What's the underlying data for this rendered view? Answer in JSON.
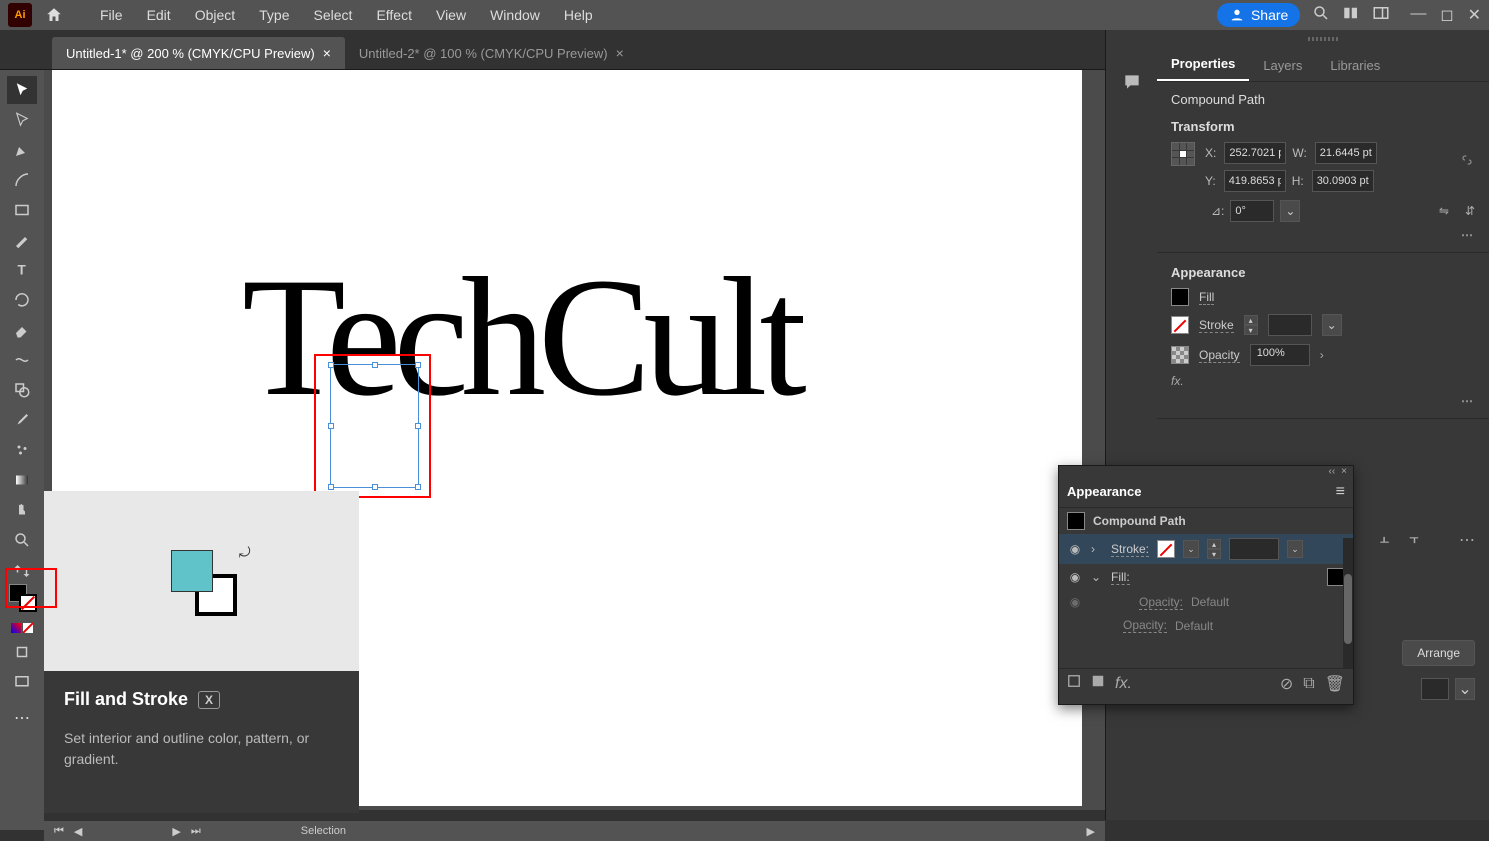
{
  "menubar": {
    "items": [
      "File",
      "Edit",
      "Object",
      "Type",
      "Select",
      "Effect",
      "View",
      "Window",
      "Help"
    ],
    "share_label": "Share"
  },
  "tabs": [
    {
      "label": "Untitled-1* @ 200 % (CMYK/CPU Preview)",
      "active": true
    },
    {
      "label": "Untitled-2* @ 100 % (CMYK/CPU Preview)",
      "active": false
    }
  ],
  "canvas_text": "TechCult",
  "tooltip": {
    "title": "Fill and Stroke",
    "shortcut": "X",
    "description": "Set interior and outline color, pattern, or gradient."
  },
  "status": {
    "mode": "Selection"
  },
  "properties": {
    "tabs": [
      "Properties",
      "Layers",
      "Libraries"
    ],
    "object_type": "Compound Path",
    "transform": {
      "title": "Transform",
      "x_label": "X:",
      "x": "252.7021 p",
      "y_label": "Y:",
      "y": "419.8653 p",
      "w_label": "W:",
      "w": "21.6445 pt",
      "h_label": "H:",
      "h": "30.0903 pt",
      "angle_label": "⊿:",
      "angle": "0°"
    },
    "appearance": {
      "title": "Appearance",
      "fill_label": "Fill",
      "stroke_label": "Stroke",
      "opacity_label": "Opacity",
      "opacity_value": "100%",
      "fx_label": "fx."
    },
    "arrange_label": "Arrange"
  },
  "appearance_panel": {
    "title": "Appearance",
    "object": "Compound Path",
    "rows": [
      {
        "label": "Stroke:",
        "kind": "none"
      },
      {
        "label": "Fill:",
        "kind": "black"
      }
    ],
    "opacity_label": "Opacity:",
    "opacity_value": "Default",
    "opacity_label2": "Opacity:",
    "opacity_value2": "Default"
  }
}
